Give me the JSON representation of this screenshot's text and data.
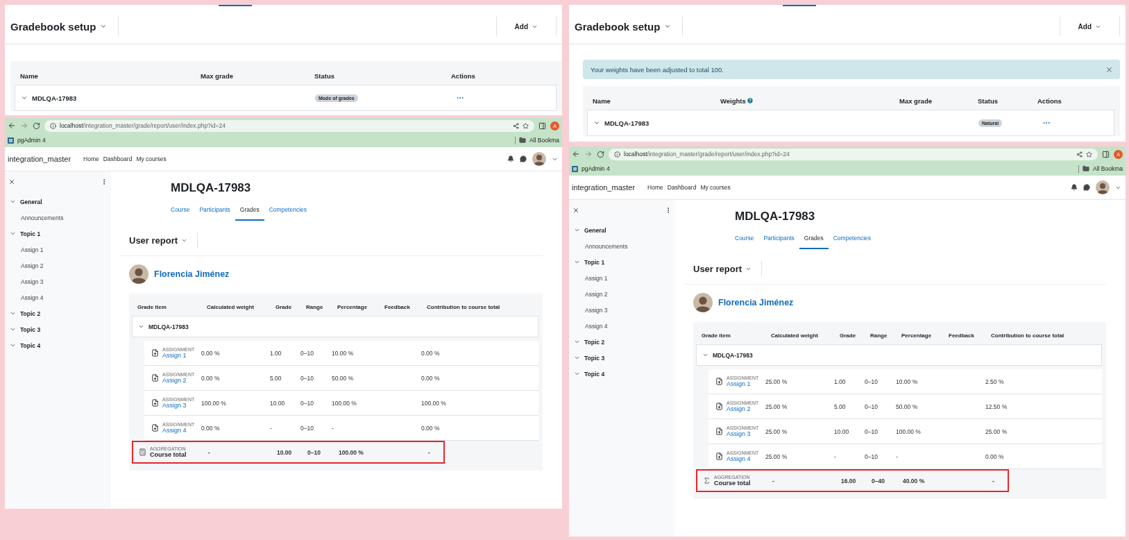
{
  "columns": [
    {
      "setup": {
        "title": "Gradebook setup",
        "add_button": "Add",
        "table_columns": [
          {
            "label": "Name",
            "help": false
          },
          {
            "label": "Max grade",
            "help": false
          },
          {
            "label": "Status",
            "help": false
          },
          {
            "label": "Actions",
            "help": false
          }
        ],
        "row": {
          "name": "MDLQA-17983",
          "status": "Mode of grades"
        }
      },
      "report": {
        "url": "**localhost**/integration_master/grade/report/user/index.php?id=24",
        "profile_initial": "A",
        "bookmarks": [
          "pgAdmin 4"
        ],
        "all_bookmarks": "All Bookma",
        "site_name": "integration_master",
        "nav": [
          "Home",
          "Dashboard",
          "My courses"
        ],
        "sidebar": [
          {
            "title": "General",
            "children": [
              "Announcements"
            ]
          },
          {
            "title": "Topic 1",
            "children": [
              "Assign 1",
              "Assign 2",
              "Assign 3",
              "Assign 4"
            ]
          },
          {
            "title": "Topic 2"
          },
          {
            "title": "Topic 3"
          },
          {
            "title": "Topic 4"
          }
        ],
        "course_title": "MDLQA-17983",
        "tabs": [
          {
            "label": "Course",
            "selected": false
          },
          {
            "label": "Participants",
            "selected": false
          },
          {
            "label": "Grades",
            "selected": true
          },
          {
            "label": "Competencies",
            "selected": false
          }
        ],
        "report_selector": "User report",
        "user_name": "Florencia Jiménez",
        "table_columns": [
          "Grade item",
          "Calculated weight",
          "Grade",
          "Range",
          "Percentage",
          "Feedback",
          "Contribution to course total"
        ],
        "category": "MDLQA-17983",
        "rows": [
          {
            "type": "ASSIGNMENT",
            "name": "Assign 1",
            "weight": "0.00 %",
            "grade": "1.00",
            "range": "0–10",
            "percentage": "10.00 %",
            "contribution": "0.00 %"
          },
          {
            "type": "ASSIGNMENT",
            "name": "Assign 2",
            "weight": "0.00 %",
            "grade": "5.00",
            "range": "0–10",
            "percentage": "50.00 %",
            "contribution": "0.00 %"
          },
          {
            "type": "ASSIGNMENT",
            "name": "Assign 3",
            "weight": "100.00 %",
            "grade": "10.00",
            "range": "0–10",
            "percentage": "100.00 %",
            "contribution": "100.00 %"
          },
          {
            "type": "ASSIGNMENT",
            "name": "Assign 4",
            "weight": "0.00 %",
            "grade": "-",
            "range": "0–10",
            "percentage": "-",
            "contribution": "0.00 %"
          }
        ],
        "total": {
          "kind": "calculator",
          "type": "AGGREGATION",
          "name": "Course total",
          "weight": "-",
          "grade": "10.00",
          "range": "0–10",
          "percentage": "100.00 %",
          "contribution": "-",
          "highlighted": true
        }
      }
    },
    {
      "setup": {
        "title": "Gradebook setup",
        "add_button": "Add",
        "alert": {
          "text": "Your weights have been adjusted to total 100.",
          "dismissible": true
        },
        "table_columns": [
          {
            "label": "Name",
            "help": false
          },
          {
            "label": "Weights",
            "help": true
          },
          {
            "label": "Max grade",
            "help": false
          },
          {
            "label": "Status",
            "help": false
          },
          {
            "label": "Actions",
            "help": false
          }
        ],
        "row": {
          "name": "MDLQA-17983",
          "status": "Natural"
        }
      },
      "report": {
        "url": "**localhost**/integration_master/grade/report/user/index.php?id=24",
        "profile_initial": "A",
        "bookmarks": [
          "pgAdmin 4"
        ],
        "all_bookmarks": "All Bookma",
        "site_name": "integration_master",
        "nav": [
          "Home",
          "Dashboard",
          "My courses"
        ],
        "sidebar": [
          {
            "title": "General",
            "children": [
              "Announcements"
            ]
          },
          {
            "title": "Topic 1",
            "children": [
              "Assign 1",
              "Assign 2",
              "Assign 3",
              "Assign 4"
            ]
          },
          {
            "title": "Topic 2"
          },
          {
            "title": "Topic 3"
          },
          {
            "title": "Topic 4"
          }
        ],
        "course_title": "MDLQA-17983",
        "tabs": [
          {
            "label": "Course",
            "selected": false
          },
          {
            "label": "Participants",
            "selected": false
          },
          {
            "label": "Grades",
            "selected": true
          },
          {
            "label": "Competencies",
            "selected": false
          }
        ],
        "report_selector": "User report",
        "user_name": "Florencia Jiménez",
        "table_columns": [
          "Grade item",
          "Calculated weight",
          "Grade",
          "Range",
          "Percentage",
          "Feedback",
          "Contribution to course total"
        ],
        "category": "MDLQA-17983",
        "rows": [
          {
            "type": "ASSIGNMENT",
            "name": "Assign 1",
            "weight": "25.00 %",
            "grade": "1.00",
            "range": "0–10",
            "percentage": "10.00 %",
            "contribution": "2.50 %"
          },
          {
            "type": "ASSIGNMENT",
            "name": "Assign 2",
            "weight": "25.00 %",
            "grade": "5.00",
            "range": "0–10",
            "percentage": "50.00 %",
            "contribution": "12.50 %"
          },
          {
            "type": "ASSIGNMENT",
            "name": "Assign 3",
            "weight": "25.00 %",
            "grade": "10.00",
            "range": "0–10",
            "percentage": "100.00 %",
            "contribution": "25.00 %"
          },
          {
            "type": "ASSIGNMENT",
            "name": "Assign 4",
            "weight": "25.00 %",
            "grade": "-",
            "range": "0–10",
            "percentage": "-",
            "contribution": "0.00 %"
          }
        ],
        "total": {
          "kind": "sigma",
          "type": "AGGREGATION",
          "name": "Course total",
          "weight": "-",
          "grade": "16.00",
          "range": "0–40",
          "percentage": "40.00 %",
          "contribution": "-",
          "highlighted": true
        }
      }
    }
  ]
}
